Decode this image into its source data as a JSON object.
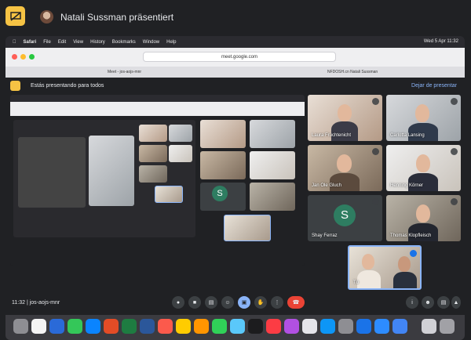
{
  "presenter": {
    "text": "Natali Sussman präsentiert"
  },
  "mac": {
    "menu": [
      "Safari",
      "File",
      "Edit",
      "View",
      "History",
      "Bookmarks",
      "Window",
      "Help"
    ],
    "clock": "Wed 5 Apr 11:32",
    "url": "meet.google.com",
    "tabs": [
      "Meet - jos-aojs-mnr",
      "NFDOSH.cn Natali Sussman"
    ]
  },
  "meet": {
    "banner": "Estás presentando para todos",
    "stop_label": "Dejar de presentar",
    "time": "11:32",
    "meeting_code": "jos-aojs-mnr",
    "participants": [
      {
        "name": "Laura Früchtenicht"
      },
      {
        "name": "Carlotta Lansing"
      },
      {
        "name": "Jan Ole Gluch"
      },
      {
        "name": "Henning Körner"
      },
      {
        "name": "Shay Ferraz",
        "initial": "S"
      },
      {
        "name": "Thomas Klopfleisch"
      },
      {
        "name": "Tú"
      }
    ]
  },
  "icons": [
    "present-screen-icon",
    "mic-icon",
    "camera-icon",
    "captions-icon",
    "emoji-icon",
    "present-icon",
    "hand-icon",
    "more-icon",
    "end-call-icon",
    "info-icon",
    "people-icon",
    "chat-icon",
    "activities-icon"
  ]
}
